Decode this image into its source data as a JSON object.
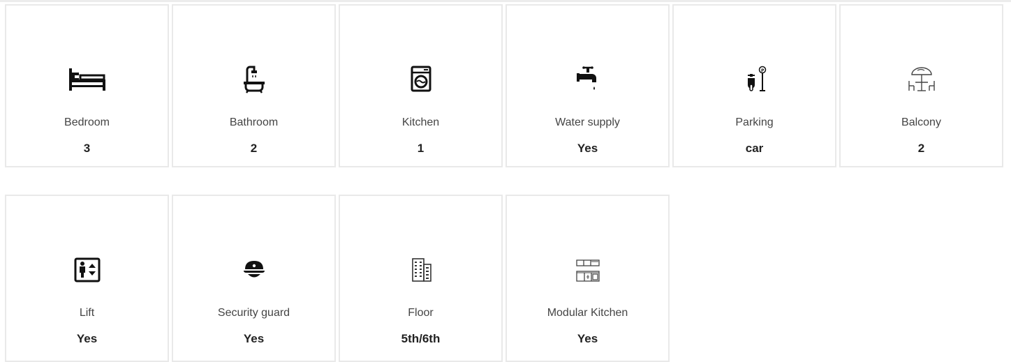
{
  "features": [
    {
      "icon": "bed-icon",
      "label": "Bedroom",
      "value": "3"
    },
    {
      "icon": "bathtub-shower-icon",
      "label": "Bathroom",
      "value": "2"
    },
    {
      "icon": "washing-machine-icon",
      "label": "Kitchen",
      "value": "1"
    },
    {
      "icon": "water-tap-icon",
      "label": "Water supply",
      "value": "Yes"
    },
    {
      "icon": "scooter-parking-icon",
      "label": "Parking",
      "value": "car"
    },
    {
      "icon": "balcony-umbrella-table-icon",
      "label": "Balcony",
      "value": "2"
    },
    {
      "icon": "elevator-icon",
      "label": "Lift",
      "value": "Yes"
    },
    {
      "icon": "security-guard-cap-icon",
      "label": "Security guard",
      "value": "Yes"
    },
    {
      "icon": "building-floors-icon",
      "label": "Floor",
      "value": "5th/6th"
    },
    {
      "icon": "modular-kitchen-cabinets-icon",
      "label": "Modular Kitchen",
      "value": "Yes"
    }
  ]
}
